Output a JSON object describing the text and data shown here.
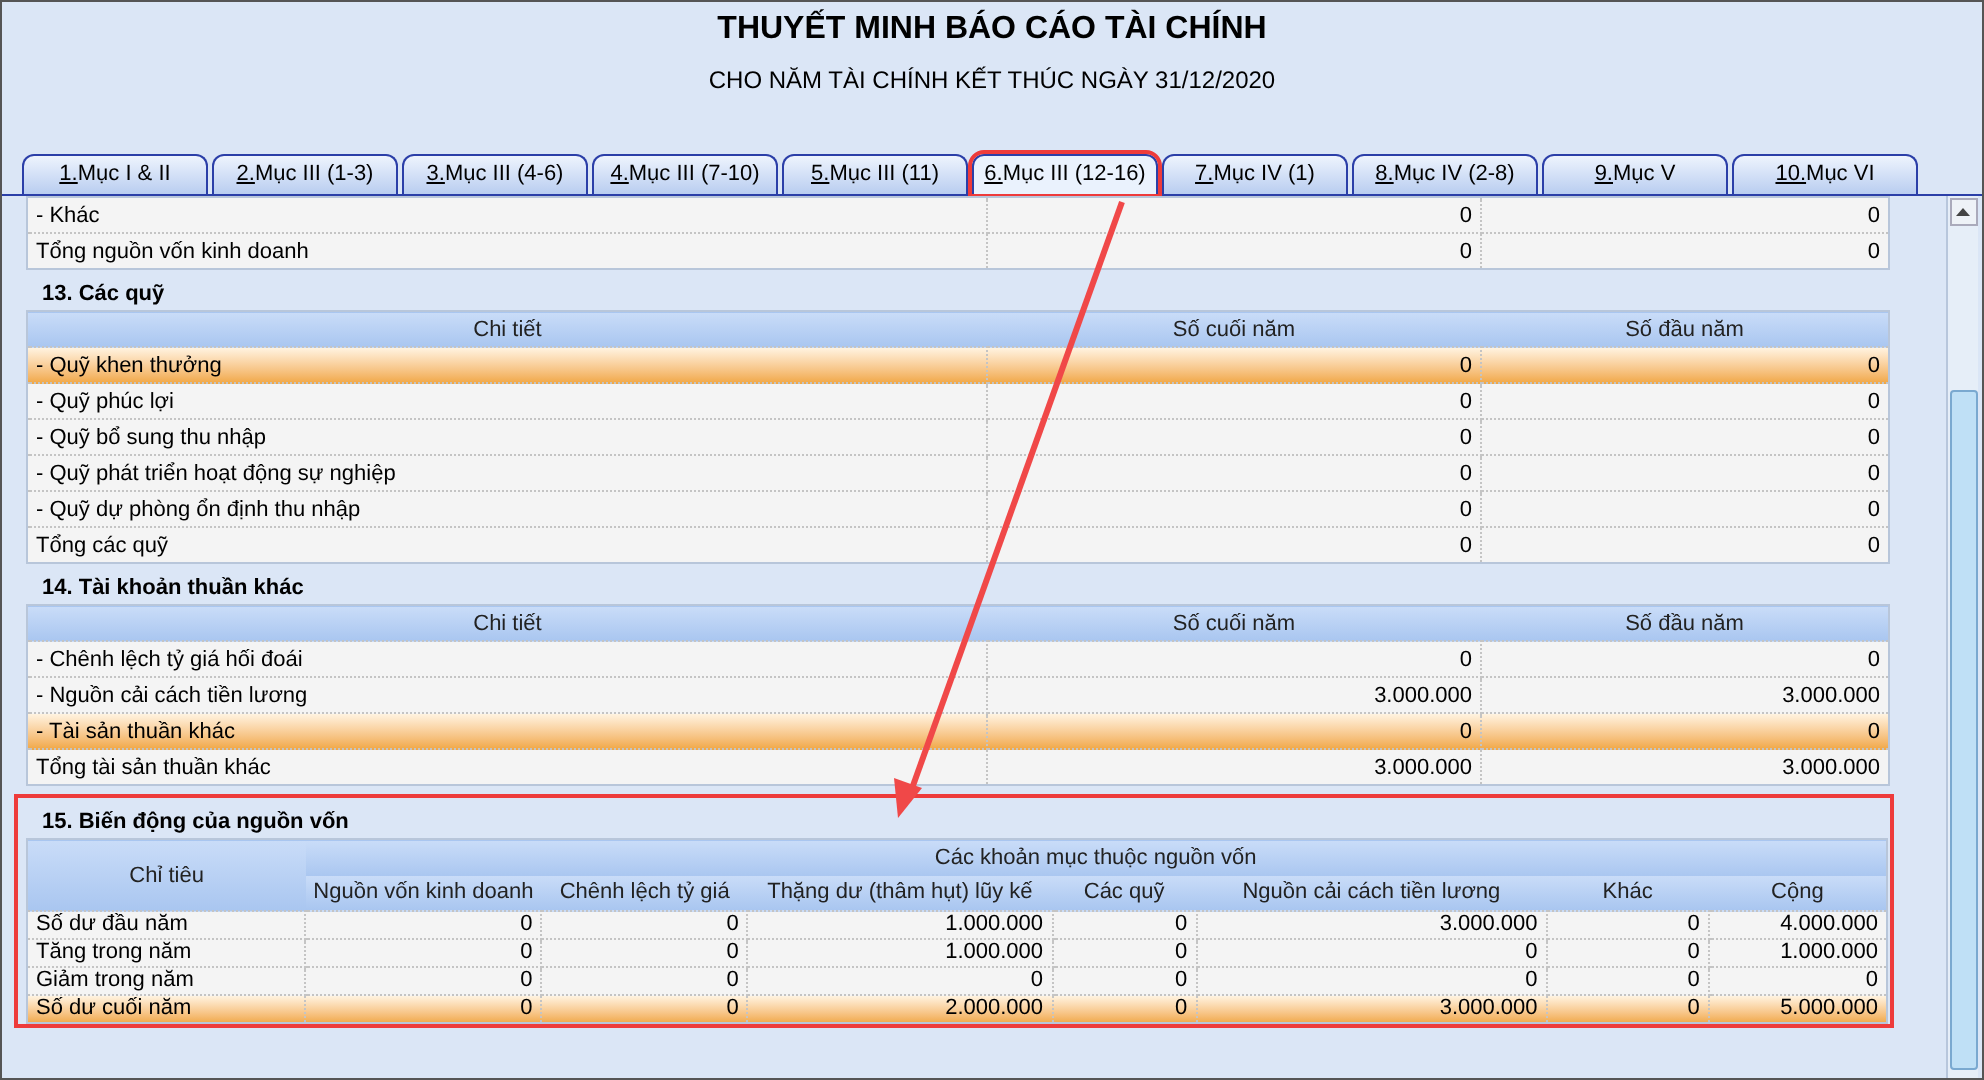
{
  "title": "THUYẾT MINH BÁO CÁO TÀI CHÍNH",
  "subtitle": "CHO NĂM TÀI CHÍNH KẾT THÚC NGÀY 31/12/2020",
  "tabs": [
    {
      "number": "1.",
      "label": " Mục I & II",
      "selected": false,
      "annotated": false
    },
    {
      "number": "2.",
      "label": " Mục III (1-3)",
      "selected": false,
      "annotated": false
    },
    {
      "number": "3.",
      "label": " Mục III (4-6)",
      "selected": false,
      "annotated": false
    },
    {
      "number": "4.",
      "label": " Mục III (7-10)",
      "selected": false,
      "annotated": false
    },
    {
      "number": "5.",
      "label": " Mục III (11)",
      "selected": false,
      "annotated": false
    },
    {
      "number": "6.",
      "label": " Mục III (12-16)",
      "selected": true,
      "annotated": true
    },
    {
      "number": "7.",
      "label": " Mục IV (1)",
      "selected": false,
      "annotated": false
    },
    {
      "number": "8.",
      "label": " Mục IV (2-8)",
      "selected": false,
      "annotated": false
    },
    {
      "number": "9.",
      "label": " Mục V",
      "selected": false,
      "annotated": false
    },
    {
      "number": "10.",
      "label": " Mục VI",
      "selected": false,
      "annotated": false
    }
  ],
  "sections": [
    {
      "kind": "simple",
      "rows": [
        {
          "cells": [
            "- Khác",
            "0",
            "0"
          ],
          "selected": false
        },
        {
          "cells": [
            "Tổng nguồn vốn kinh doanh",
            "0",
            "0"
          ],
          "selected": false
        }
      ]
    },
    {
      "kind": "simple",
      "title": "13. Các quỹ",
      "columns": [
        "Chi tiết",
        "Số cuối năm",
        "Số đầu năm"
      ],
      "rows": [
        {
          "cells": [
            "- Quỹ khen thưởng",
            "0",
            "0"
          ],
          "selected": true
        },
        {
          "cells": [
            "- Quỹ phúc lợi",
            "0",
            "0"
          ],
          "selected": false
        },
        {
          "cells": [
            "- Quỹ bổ sung thu nhập",
            "0",
            "0"
          ],
          "selected": false
        },
        {
          "cells": [
            "- Quỹ phát triển hoạt động sự nghiệp",
            "0",
            "0"
          ],
          "selected": false
        },
        {
          "cells": [
            "- Quỹ dự phòng ổn định thu nhập",
            "0",
            "0"
          ],
          "selected": false
        },
        {
          "cells": [
            "Tổng các quỹ",
            "0",
            "0"
          ],
          "selected": false
        }
      ]
    },
    {
      "kind": "simple",
      "title": "14. Tài khoản thuần khác",
      "columns": [
        "Chi tiết",
        "Số cuối năm",
        "Số đầu năm"
      ],
      "rows": [
        {
          "cells": [
            "- Chênh lệch tỷ giá hối đoái",
            "0",
            "0"
          ],
          "selected": false
        },
        {
          "cells": [
            "- Nguồn cải cách tiền lương",
            "3.000.000",
            "3.000.000"
          ],
          "selected": false
        },
        {
          "cells": [
            "- Tài sản thuần khác",
            "0",
            "0"
          ],
          "selected": true
        },
        {
          "cells": [
            "Tổng tài sản thuần khác",
            "3.000.000",
            "3.000.000"
          ],
          "selected": false
        }
      ]
    },
    {
      "kind": "matrix",
      "title": "15. Biến động của nguồn vốn",
      "annotated": true,
      "group_header": "Các khoản mục thuộc nguồn vốn",
      "columns": [
        "Chỉ tiêu",
        "Nguồn vốn kinh doanh",
        "Chênh lệch tỷ giá",
        "Thặng dư (thâm hụt) lũy kế",
        "Các quỹ",
        "Nguồn cải cách tiền lương",
        "Khác",
        "Cộng"
      ],
      "rows": [
        {
          "cells": [
            "Số dư đầu năm",
            "0",
            "0",
            "1.000.000",
            "0",
            "3.000.000",
            "0",
            "4.000.000"
          ],
          "selected": false
        },
        {
          "cells": [
            "Tăng trong năm",
            "0",
            "0",
            "1.000.000",
            "0",
            "0",
            "0",
            "1.000.000"
          ],
          "selected": false
        },
        {
          "cells": [
            "Giảm trong năm",
            "0",
            "0",
            "0",
            "0",
            "0",
            "0",
            "0"
          ],
          "selected": false
        },
        {
          "cells": [
            "Số dư cuối năm",
            "0",
            "0",
            "2.000.000",
            "0",
            "3.000.000",
            "0",
            "5.000.000"
          ],
          "selected": true
        }
      ]
    }
  ]
}
